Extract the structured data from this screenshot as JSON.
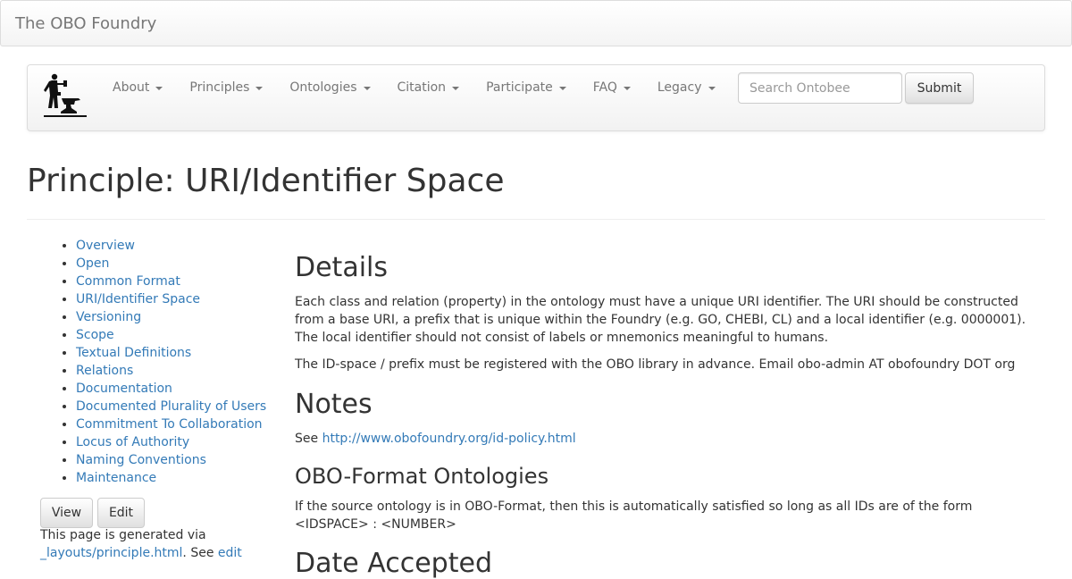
{
  "topbar": {
    "brand": "The OBO Foundry"
  },
  "navbar": {
    "logo_alt": "blacksmith-anvil-icon",
    "menu": [
      "About",
      "Principles",
      "Ontologies",
      "Citation",
      "Participate",
      "FAQ",
      "Legacy"
    ],
    "search": {
      "placeholder": "Search Ontobee",
      "value": ""
    },
    "submit_label": "Submit"
  },
  "page": {
    "title": "Principle: URI/Identifier Space"
  },
  "sidebar": {
    "items": [
      "Overview",
      "Open",
      "Common Format",
      "URI/Identifier Space",
      "Versioning",
      "Scope",
      "Textual Definitions",
      "Relations",
      "Documentation",
      "Documented Plurality of Users",
      "Commitment To Collaboration",
      "Locus of Authority",
      "Naming Conventions",
      "Maintenance"
    ],
    "view_label": "View",
    "edit_label": "Edit",
    "generated_prefix": "This page is generated via",
    "generated_link": "_layouts/principle.html",
    "generated_middle": ". See ",
    "generated_edit": "edit"
  },
  "content": {
    "details_heading": "Details",
    "details_p1": "Each class and relation (property) in the ontology must have a unique URI identifier. The URI should be constructed from a base URI, a prefix that is unique within the Foundry (e.g. GO, CHEBI, CL) and a local identifier (e.g. 0000001). The local identifier should not consist of labels or mnemonics meaningful to humans.",
    "details_p2": "The ID-space / prefix must be registered with the OBO library in advance. Email obo-admin AT obofoundry DOT org",
    "notes_heading": "Notes",
    "notes_see": "See ",
    "notes_link": "http://www.obofoundry.org/id-policy.html",
    "obo_heading": "OBO-Format Ontologies",
    "obo_p": "If the source ontology is in OBO-Format, then this is automatically satisfied so long as all IDs are of the form <IDSPACE> : <NUMBER>",
    "date_heading": "Date Accepted"
  },
  "colors": {
    "link": "#337ab7",
    "nav_text": "#777777",
    "text": "#333333"
  }
}
